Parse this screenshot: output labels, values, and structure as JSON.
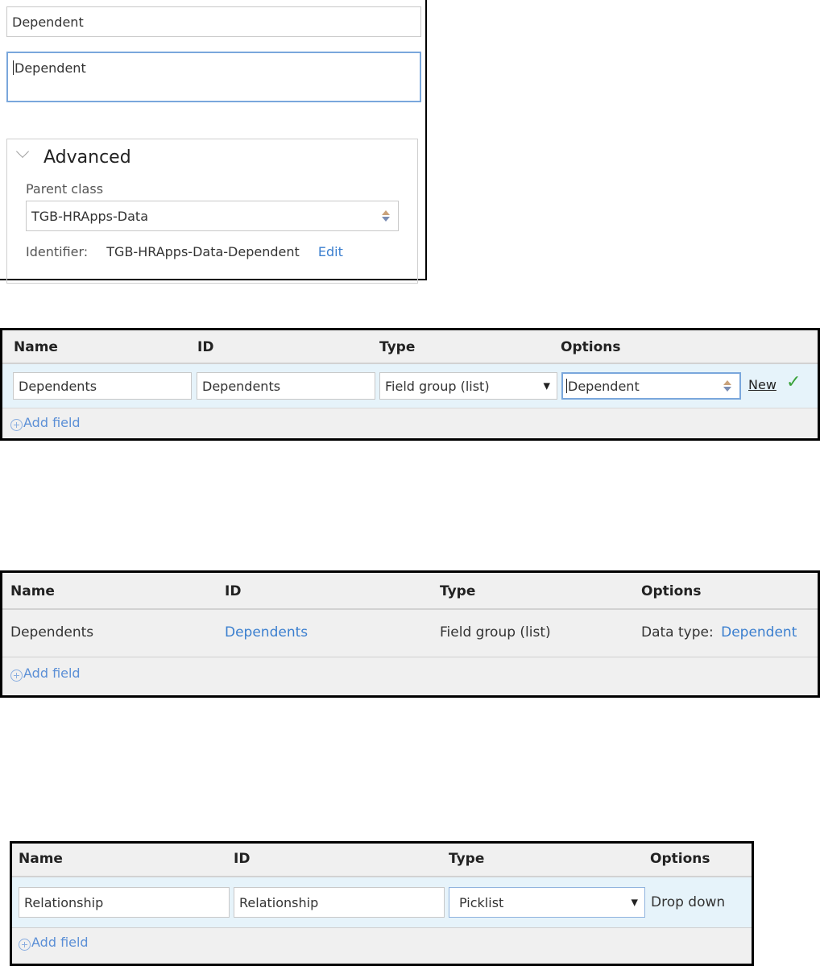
{
  "form": {
    "name_value": "Dependent",
    "description_value": "Dependent",
    "advanced": {
      "title": "Advanced",
      "parent_class_label": "Parent class",
      "parent_class_value": "TGB-HRApps-Data",
      "identifier_label": "Identifier:",
      "identifier_value": "TGB-HRApps-Data-Dependent",
      "edit_link": "Edit"
    }
  },
  "table1": {
    "headers": [
      "Name",
      "ID",
      "Type",
      "Options"
    ],
    "row": {
      "name": "Dependents",
      "id": "Dependents",
      "type": "Field group (list)",
      "options": "Dependent",
      "new_link": "New",
      "check_icon": "checkmark-icon"
    },
    "add_field": "Add field"
  },
  "table2": {
    "headers": [
      "Name",
      "ID",
      "Type",
      "Options"
    ],
    "row": {
      "name": "Dependents",
      "id": "Dependents",
      "type": "Field group (list)",
      "options_label": "Data type:",
      "options_value": "Dependent"
    },
    "add_field": "Add field"
  },
  "table3": {
    "headers": [
      "Name",
      "ID",
      "Type",
      "Options"
    ],
    "row": {
      "name": "Relationship",
      "id": "Relationship",
      "type": "Picklist",
      "options": "Drop down"
    },
    "add_field": "Add field"
  },
  "colors": {
    "link": "#3b7fcf",
    "row_highlight": "#e6f3fa",
    "check": "#3aa23a",
    "focus_border": "#7aa7dc"
  }
}
